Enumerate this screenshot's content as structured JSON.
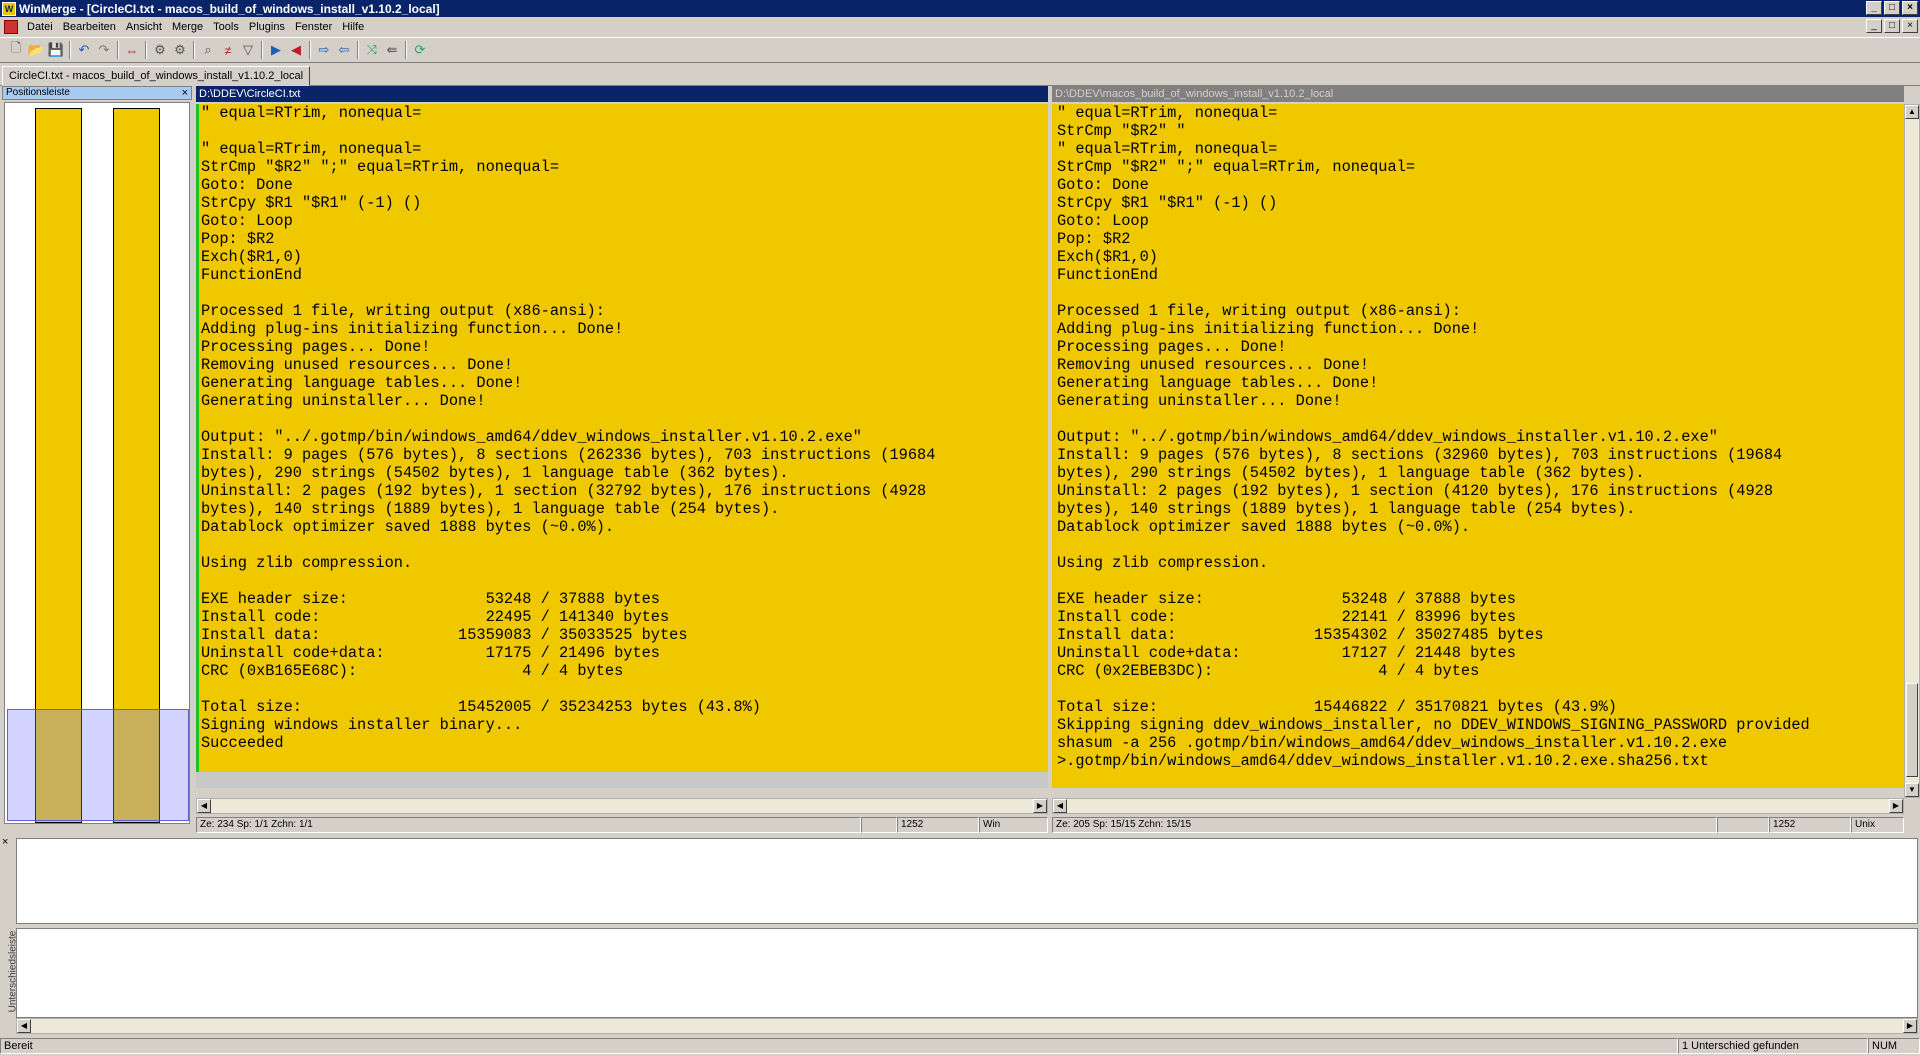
{
  "window": {
    "title": "WinMerge - [CircleCI.txt - macos_build_of_windows_install_v1.10.2_local]",
    "min": "_",
    "max": "□",
    "close": "×"
  },
  "menu": [
    "Datei",
    "Bearbeiten",
    "Ansicht",
    "Merge",
    "Tools",
    "Plugins",
    "Fenster",
    "Hilfe"
  ],
  "toolbar": {
    "icons": [
      "new-icon",
      "open-icon",
      "save-icon",
      "sep",
      "undo-icon",
      "redo-icon",
      "sep",
      "compare-icon",
      "sep",
      "options-icon",
      "settings-icon",
      "sep",
      "zoom-icon",
      "diff-icon",
      "filter-icon",
      "sep",
      "next-diff-icon",
      "prev-diff-icon",
      "sep",
      "copy-right-icon",
      "copy-left-icon",
      "sep",
      "merge-icon",
      "copy-all-left-icon",
      "sep",
      "refresh-icon"
    ]
  },
  "tab": {
    "label": "CircleCI.txt - macos_build_of_windows_install_v1.10.2_local"
  },
  "location_pane": {
    "title": "Positionsleiste",
    "close": "×"
  },
  "left": {
    "path": "D:\\DDEV\\CircleCI.txt",
    "lines": [
      "\" equal=RTrim, nonequal=",
      "",
      "\" equal=RTrim, nonequal=",
      "StrCmp \"$R2\" \";\" equal=RTrim, nonequal=",
      "Goto: Done",
      "StrCpy $R1 \"$R1\" (-1) ()",
      "Goto: Loop",
      "Pop: $R2",
      "Exch($R1,0)",
      "FunctionEnd",
      "",
      "Processed 1 file, writing output (x86-ansi):",
      "Adding plug-ins initializing function... Done!",
      "Processing pages... Done!",
      "Removing unused resources... Done!",
      "Generating language tables... Done!",
      "Generating uninstaller... Done!",
      "",
      "Output: \"../.gotmp/bin/windows_amd64/ddev_windows_installer.v1.10.2.exe\"",
      "Install: 9 pages (576 bytes), 8 sections (262336 bytes), 703 instructions (19684",
      "bytes), 290 strings (54502 bytes), 1 language table (362 bytes).",
      "Uninstall: 2 pages (192 bytes), 1 section (32792 bytes), 176 instructions (4928",
      "bytes), 140 strings (1889 bytes), 1 language table (254 bytes).",
      "Datablock optimizer saved 1888 bytes (~0.0%).",
      "",
      "Using zlib compression.",
      "",
      "EXE header size:               53248 / 37888 bytes",
      "Install code:                  22495 / 141340 bytes",
      "Install data:               15359083 / 35033525 bytes",
      "Uninstall code+data:           17175 / 21496 bytes",
      "CRC (0xB165E68C):                  4 / 4 bytes",
      "",
      "Total size:                 15452005 / 35234253 bytes (43.8%)",
      "Signing windows installer binary...",
      "Succeeded"
    ],
    "status": {
      "ze": "Ze: 234  Sp: 1/1  Zchn: 1/1",
      "codepage": "1252",
      "eol": "Win"
    }
  },
  "right": {
    "path": "D:\\DDEV\\macos_build_of_windows_install_v1.10.2_local",
    "lines": [
      "\" equal=RTrim, nonequal=",
      "StrCmp \"$R2\" \"",
      "\" equal=RTrim, nonequal=",
      "StrCmp \"$R2\" \";\" equal=RTrim, nonequal=",
      "Goto: Done",
      "StrCpy $R1 \"$R1\" (-1) ()",
      "Goto: Loop",
      "Pop: $R2",
      "Exch($R1,0)",
      "FunctionEnd",
      "",
      "Processed 1 file, writing output (x86-ansi):",
      "Adding plug-ins initializing function... Done!",
      "Processing pages... Done!",
      "Removing unused resources... Done!",
      "Generating language tables... Done!",
      "Generating uninstaller... Done!",
      "",
      "Output: \"../.gotmp/bin/windows_amd64/ddev_windows_installer.v1.10.2.exe\"",
      "Install: 9 pages (576 bytes), 8 sections (32960 bytes), 703 instructions (19684",
      "bytes), 290 strings (54502 bytes), 1 language table (362 bytes).",
      "Uninstall: 2 pages (192 bytes), 1 section (4120 bytes), 176 instructions (4928",
      "bytes), 140 strings (1889 bytes), 1 language table (254 bytes).",
      "Datablock optimizer saved 1888 bytes (~0.0%).",
      "",
      "Using zlib compression.",
      "",
      "EXE header size:               53248 / 37888 bytes",
      "Install code:                  22141 / 83996 bytes",
      "Install data:               15354302 / 35027485 bytes",
      "Uninstall code+data:           17127 / 21448 bytes",
      "CRC (0x2EBEB3DC):                  4 / 4 bytes",
      "",
      "Total size:                 15446822 / 35170821 bytes (43.9%)",
      "Skipping signing ddev_windows_installer, no DDEV_WINDOWS_SIGNING_PASSWORD provided",
      "shasum -a 256 .gotmp/bin/windows_amd64/ddev_windows_installer.v1.10.2.exe",
      ">.gotmp/bin/windows_amd64/ddev_windows_installer.v1.10.2.exe.sha256.txt"
    ],
    "status": {
      "ze": "Ze: 205  Sp: 15/15  Zchn: 15/15",
      "codepage": "1252",
      "eol": "Unix"
    }
  },
  "diff_pane": {
    "label": "Unterschiedsleiste",
    "close": "×"
  },
  "statusbar": {
    "ready": "Bereit",
    "diffs": "1 Unterschied gefunden",
    "num": "NUM"
  }
}
